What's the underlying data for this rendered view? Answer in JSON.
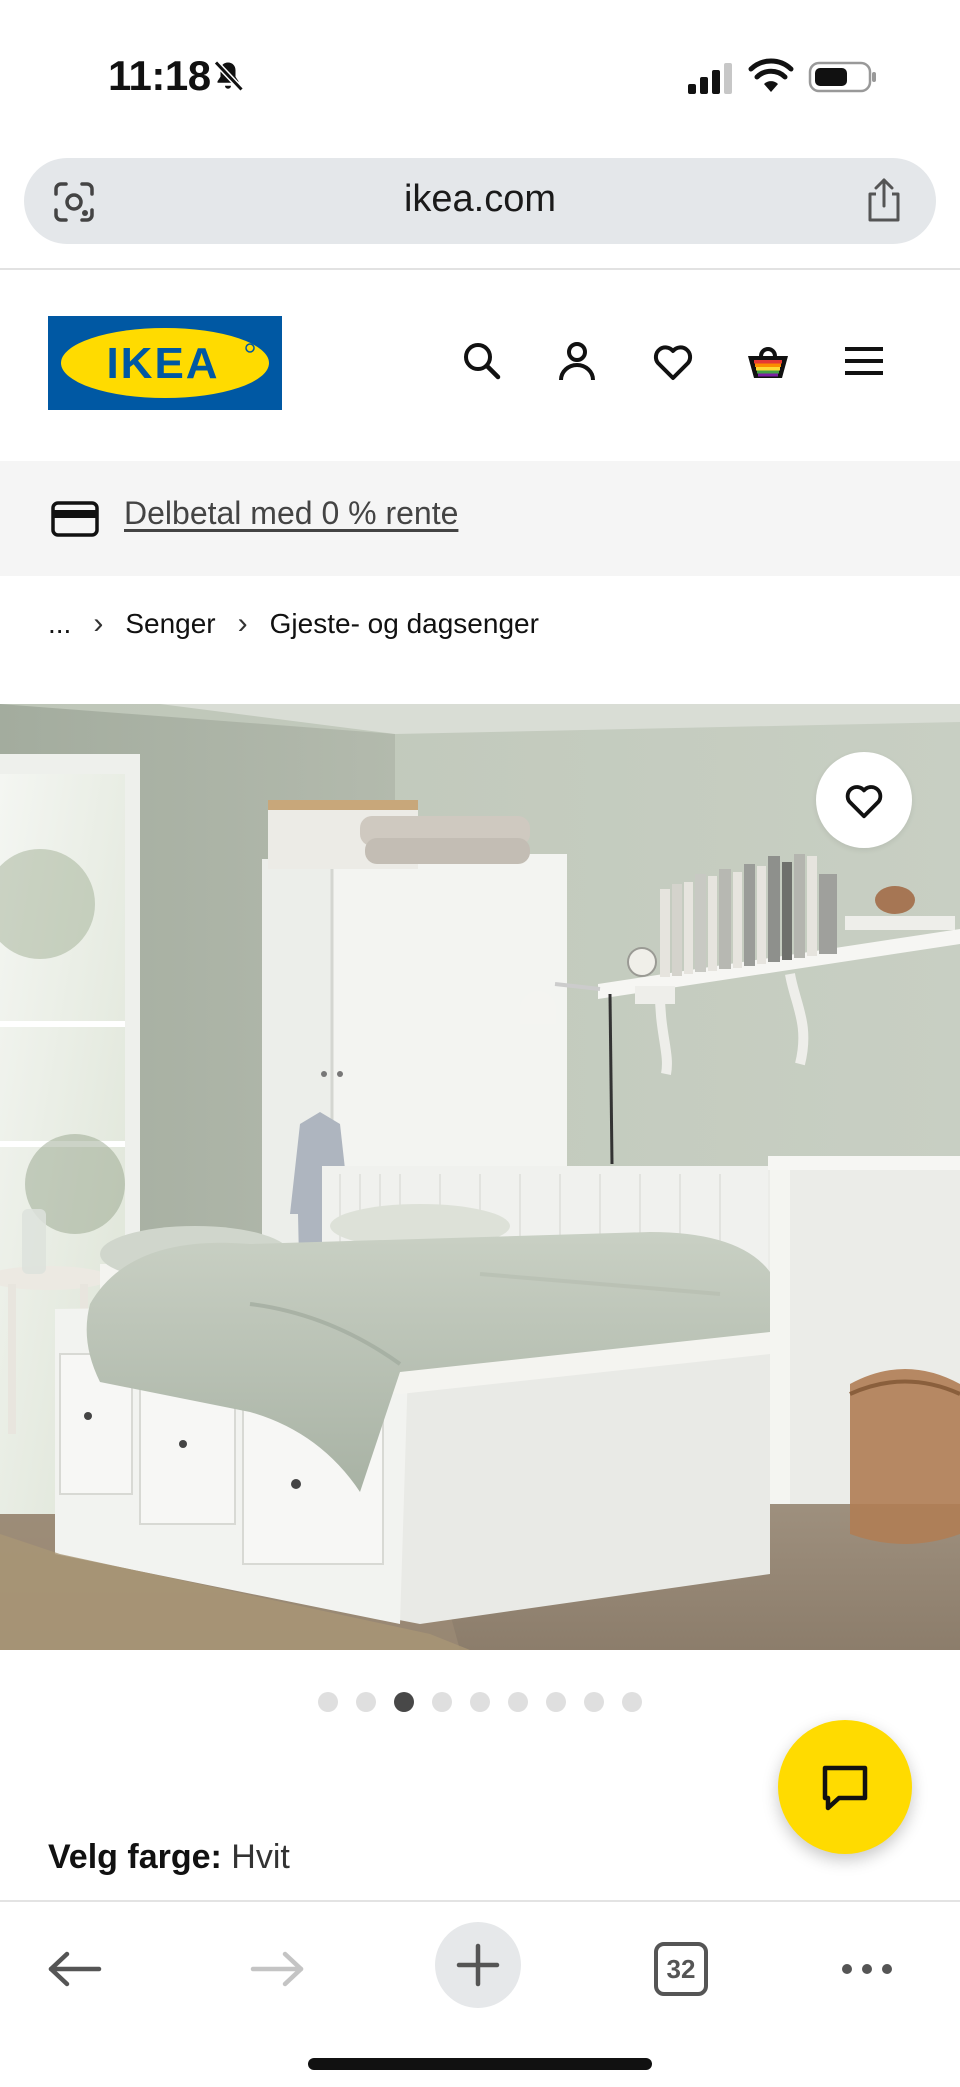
{
  "status": {
    "time": "11:18"
  },
  "browser": {
    "url": "ikea.com",
    "tab_count": "32"
  },
  "header": {
    "logo_text": "IKEA"
  },
  "promo": {
    "text": "Delbetal med 0 % rente"
  },
  "breadcrumb": {
    "ellipsis": "...",
    "items": [
      "Senger",
      "Gjeste- og dagsenger"
    ]
  },
  "carousel": {
    "total": 9,
    "active_index": 2
  },
  "product": {
    "color_label": "Velg farge:",
    "color_value": "Hvit"
  },
  "colors": {
    "ikea_blue": "#0058a3",
    "ikea_yellow": "#ffdb00",
    "chat": "#ffdb00"
  }
}
